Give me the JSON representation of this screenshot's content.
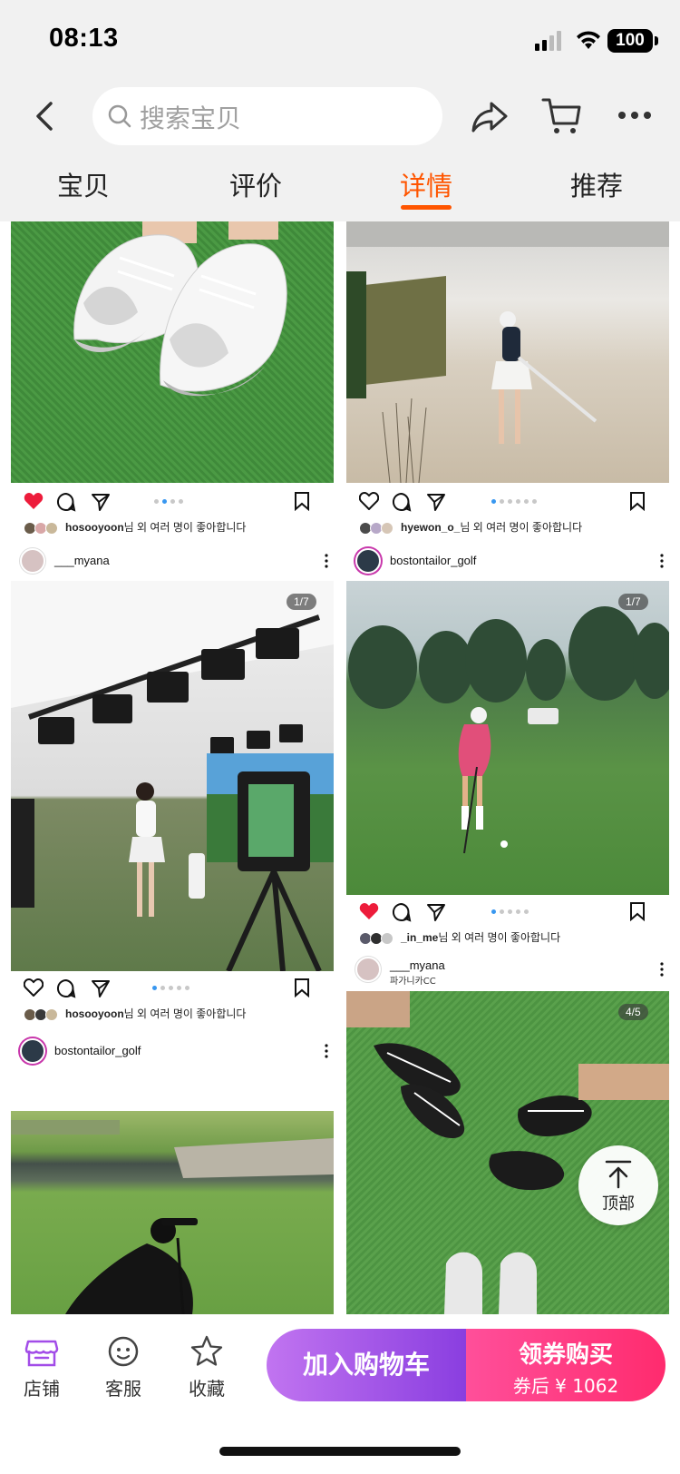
{
  "status": {
    "time": "08:13",
    "battery": "100"
  },
  "nav": {
    "search_placeholder": "搜索宝贝"
  },
  "tabs": [
    {
      "label": "宝贝"
    },
    {
      "label": "评价"
    },
    {
      "label": "详情"
    },
    {
      "label": "推荐"
    }
  ],
  "feed": {
    "post1": {
      "likes_user": "hosooyoon",
      "likes_suffix": "님 외 여러 명이 좋아합니다"
    },
    "post2": {
      "likes_user": "hyewon_o_",
      "likes_suffix": "님 외 여러 명이 좋아합니다"
    },
    "post3": {
      "user": "___myana",
      "counter": "1/7",
      "likes_user": "hosooyoon",
      "likes_suffix": "님 외 여러 명이 좋아합니다"
    },
    "post4": {
      "user": "bostontailor_golf",
      "counter": "1/7",
      "likes_user": "_in_me",
      "likes_suffix": "님 외 여러 명이 좋아합니다"
    },
    "post5": {
      "user": "bostontailor_golf"
    },
    "post6": {
      "user": "___myana",
      "location": "파가니카CC",
      "counter": "4/5"
    }
  },
  "to_top": {
    "label": "顶部"
  },
  "bottom": {
    "shop": "店铺",
    "service": "客服",
    "favorite": "收藏",
    "add_cart": "加入购物车",
    "buy": "领券购买",
    "after_coupon": "券后 ¥ 1062"
  },
  "colors": {
    "accent": "#ff5500",
    "cart_btn": "#8a3ee0",
    "buy_btn": "#ff2b6e",
    "ig_like": "#ed1c3b",
    "ig_dot": "#3897f0"
  }
}
